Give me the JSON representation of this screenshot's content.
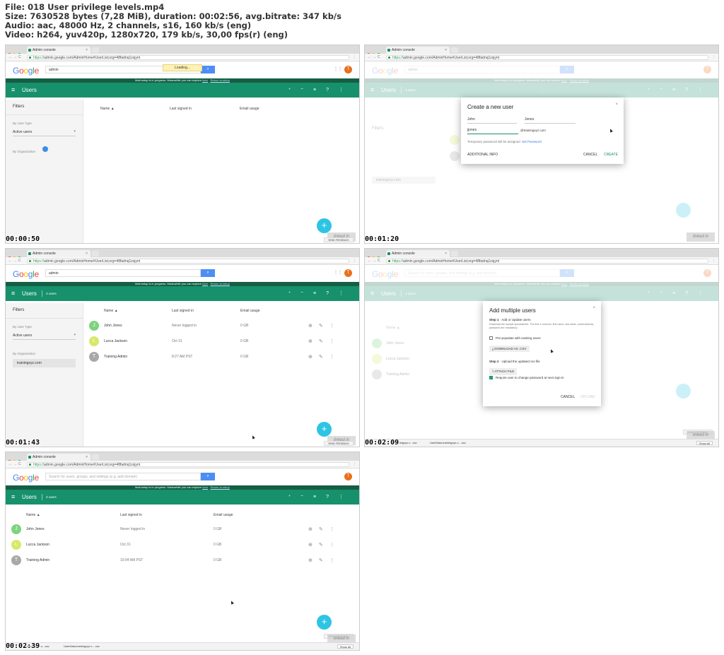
{
  "meta": {
    "file": "File: 018 User privilege levels.mp4",
    "size": "Size: 7630528 bytes (7,28 MiB), duration: 00:02:56, avg.bitrate: 347 kb/s",
    "audio": "Audio: aac, 48000 Hz, 2 channels, s16, 160 kb/s (eng)",
    "video": "Video: h264, yuv420p, 1280x720, 179 kb/s, 30,00 fps(r) (eng)"
  },
  "common": {
    "tab_title": "Admin console",
    "url_https": "https://",
    "url_rest": "admin.google.com/AdminHome#UserList;org=48fadnq1zsjynt",
    "logo": [
      "G",
      "o",
      "o",
      "g",
      "l",
      "e"
    ],
    "search_admin": "admin",
    "search_placeholder": "Search for users, groups, and settings (e.g. add domain)",
    "avatar_letter": "T",
    "setup_msg": "Mail setup is in progress. Meanwhile you can explore",
    "setup_here": "here",
    "setup_return": "Return to setup",
    "app_title": "Users",
    "user_count": "3 users",
    "filters_title": "Filters",
    "by_user_type": "By User Type",
    "active_users": "Active users",
    "by_org": "By Organization",
    "org_name": "trainingxyz.com",
    "col_name": "Name",
    "col_last": "Last signed in",
    "col_email": "Email usage",
    "send_feedback": "SEND FEEDBACK",
    "fab": "+",
    "watermark": "linked in",
    "loading": "Loading..."
  },
  "users": [
    {
      "initial": "J",
      "name": "John Jones",
      "last": "Never logged in",
      "usage": "0 GB",
      "color": "#7ed37f"
    },
    {
      "initial": "L",
      "name": "Lucca Jackson",
      "last": "Oct 31",
      "usage": "0 GB",
      "color": "#d8e86a"
    },
    {
      "initial": "T",
      "name": "Training Admin",
      "last": "8:27 AM PST",
      "usage": "0 GB",
      "color": "#a8a8a8"
    }
  ],
  "frame5_last_admin": "10:04 AM PST",
  "frames": {
    "f1": {
      "timestamp": "00:00:50"
    },
    "f2": {
      "timestamp": "00:01:20"
    },
    "f3": {
      "timestamp": "00:01:43"
    },
    "f4": {
      "timestamp": "00:02:09"
    },
    "f5": {
      "timestamp": "00:02:39"
    }
  },
  "create_dialog": {
    "title": "Create a new user",
    "first": "John",
    "last": "Jones",
    "username": "jjones",
    "domain": "@trainingxyz.com",
    "temp_pw": "Temporary password will be assigned",
    "set_pw": "Set Password",
    "additional": "ADDITIONAL INFO",
    "cancel": "CANCEL",
    "create": "CREATE"
  },
  "multi_dialog": {
    "title": "Add multiple users",
    "step1_bold": "Step 1",
    "step1": " · Add or Update users",
    "step1_desc": "Download the sample spreadsheet. The first 4 columns: first name, last name, email address, password are mandatory.",
    "prepopulate": "Pre-populate with existing users",
    "download": "DOWNLOAD AS .CSV",
    "step2_bold": "Step 2",
    "step2": " · Upload the updated csv file",
    "attach": "ATTACH FILE",
    "require": "Require user to change password at next sign-in",
    "cancel": "CANCEL",
    "upload": "UPLOAD"
  },
  "downloads": {
    "item1": "trainingxyz.c...csv",
    "item2": "UserData-trainingxyz.c....csv",
    "show_all": "Show all"
  }
}
